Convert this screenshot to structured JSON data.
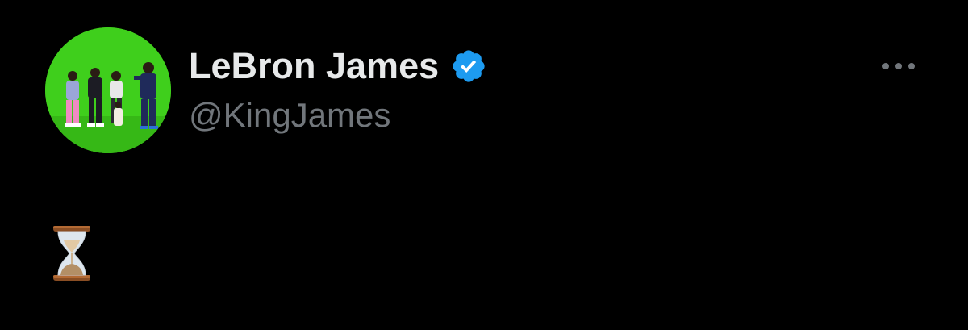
{
  "tweet": {
    "author": {
      "display_name": "LeBron James",
      "handle": "@KingJames",
      "verified": true,
      "avatar_icon": "profile-photo"
    },
    "more_icon": "more-options-icon",
    "body_emoji": "⏳",
    "body_icon": "hourglass-icon"
  },
  "colors": {
    "background": "#000000",
    "name_text": "#e7e9ea",
    "handle_text": "#71767b",
    "verified_badge": "#1d9bf0",
    "avatar_green": "#3fcf1c"
  }
}
